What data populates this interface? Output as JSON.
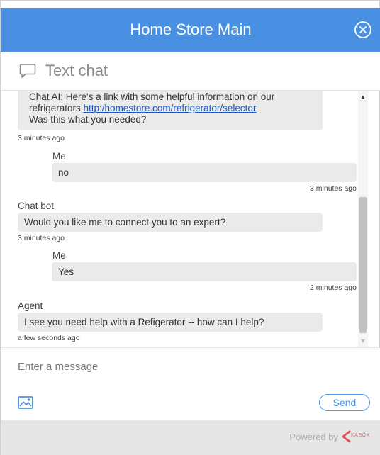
{
  "header": {
    "title": "Home Store Main",
    "close_icon": "close-circle-icon",
    "color": "#4a90e2"
  },
  "mode": {
    "icon": "chat-bubble-icon",
    "label": "Text chat"
  },
  "messages": [
    {
      "kind": "incoming",
      "text_before_link": "Chat AI: Here's a link with some helpful information on our refrigerators ",
      "link": "http:/homestore.com/refrigerator/selector",
      "text_after_link": "Was this what you needed?",
      "time": "3 minutes ago"
    },
    {
      "kind": "outgoing",
      "sender": "Me",
      "text": "no",
      "time": "3 minutes ago"
    },
    {
      "kind": "incoming",
      "sender": "Chat bot",
      "text": "Would you like me to connect you to an expert?",
      "time": "3 minutes ago"
    },
    {
      "kind": "outgoing",
      "sender": "Me",
      "text": "Yes",
      "time": "2 minutes ago"
    },
    {
      "kind": "incoming",
      "sender": "Agent",
      "text": "I see you need help with a Refigerator -- how can I help?",
      "time": "a few seconds ago"
    }
  ],
  "composer": {
    "placeholder": "Enter a message",
    "image_icon": "image-icon",
    "send_label": "Send"
  },
  "footer": {
    "powered_by": "Powered by",
    "brand": "KASOX"
  }
}
